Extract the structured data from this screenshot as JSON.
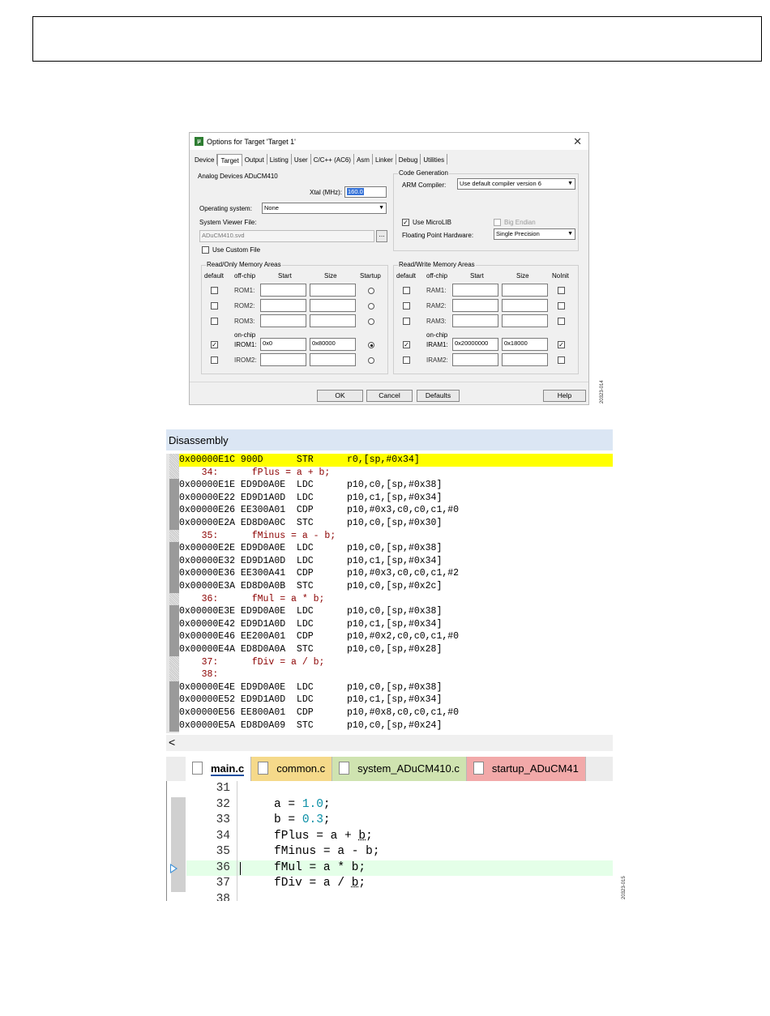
{
  "figure_ids": {
    "dialog": "20323-014",
    "editor": "20323-015"
  },
  "dialog": {
    "title": "Options for Target 'Target 1'",
    "close": "✕",
    "tabs": [
      "Device",
      "Target",
      "Output",
      "Listing",
      "User",
      "C/C++ (AC6)",
      "Asm",
      "Linker",
      "Debug",
      "Utilities"
    ],
    "device": "Analog Devices ADuCM410",
    "xtal_label": "Xtal (MHz):",
    "xtal_value": "160.0",
    "os_label": "Operating system:",
    "os_value": "None",
    "svf_label": "System Viewer File:",
    "svf_value": "ADuCM410.svd",
    "browse": "...",
    "use_custom": "Use Custom File",
    "code_gen": {
      "title": "Code Generation",
      "compiler_label": "ARM Compiler:",
      "compiler_value": "Use default compiler version 6",
      "microlib": "Use MicroLIB",
      "big_endian": "Big Endian",
      "fph_label": "Floating Point Hardware:",
      "fph_value": "Single Precision"
    },
    "ro": {
      "title": "Read/Only Memory Areas",
      "headers": [
        "default",
        "off-chip",
        "Start",
        "Size",
        "Startup"
      ],
      "onchip": "on-chip",
      "rows": [
        {
          "name": "ROM1:",
          "start": "",
          "size": "",
          "default": false,
          "startup": false
        },
        {
          "name": "ROM2:",
          "start": "",
          "size": "",
          "default": false,
          "startup": false
        },
        {
          "name": "ROM3:",
          "start": "",
          "size": "",
          "default": false,
          "startup": false
        },
        {
          "name": "IROM1:",
          "start": "0x0",
          "size": "0x80000",
          "default": true,
          "startup": true
        },
        {
          "name": "IROM2:",
          "start": "",
          "size": "",
          "default": false,
          "startup": false
        }
      ]
    },
    "rw": {
      "title": "Read/Write Memory Areas",
      "headers": [
        "default",
        "off-chip",
        "Start",
        "Size",
        "NoInit"
      ],
      "onchip": "on-chip",
      "rows": [
        {
          "name": "RAM1:",
          "start": "",
          "size": "",
          "default": false,
          "noinit": false
        },
        {
          "name": "RAM2:",
          "start": "",
          "size": "",
          "default": false,
          "noinit": false
        },
        {
          "name": "RAM3:",
          "start": "",
          "size": "",
          "default": false,
          "noinit": false
        },
        {
          "name": "IRAM1:",
          "start": "0x20000000",
          "size": "0x18000",
          "default": true,
          "noinit": true
        },
        {
          "name": "IRAM2:",
          "start": "",
          "size": "",
          "default": false,
          "noinit": false
        }
      ]
    },
    "buttons": {
      "ok": "OK",
      "cancel": "Cancel",
      "defaults": "Defaults",
      "help": "Help"
    }
  },
  "disassembly": {
    "title": "Disassembly",
    "lines": [
      {
        "t": "0x00000E1C 900D      STR      r0,[sp,#0x34]",
        "k": "cur"
      },
      {
        "t": "    34:      fPlus = a + b;",
        "k": "src"
      },
      {
        "t": "0x00000E1E ED9D0A0E  LDC      p10,c0,[sp,#0x38]",
        "k": "asm"
      },
      {
        "t": "0x00000E22 ED9D1A0D  LDC      p10,c1,[sp,#0x34]",
        "k": "asm"
      },
      {
        "t": "0x00000E26 EE300A01  CDP      p10,#0x3,c0,c0,c1,#0",
        "k": "asm"
      },
      {
        "t": "0x00000E2A ED8D0A0C  STC      p10,c0,[sp,#0x30]",
        "k": "asm"
      },
      {
        "t": "    35:      fMinus = a - b;",
        "k": "src"
      },
      {
        "t": "0x00000E2E ED9D0A0E  LDC      p10,c0,[sp,#0x38]",
        "k": "asm"
      },
      {
        "t": "0x00000E32 ED9D1A0D  LDC      p10,c1,[sp,#0x34]",
        "k": "asm"
      },
      {
        "t": "0x00000E36 EE300A41  CDP      p10,#0x3,c0,c0,c1,#2",
        "k": "asm"
      },
      {
        "t": "0x00000E3A ED8D0A0B  STC      p10,c0,[sp,#0x2c]",
        "k": "asm"
      },
      {
        "t": "    36:      fMul = a * b;",
        "k": "src"
      },
      {
        "t": "0x00000E3E ED9D0A0E  LDC      p10,c0,[sp,#0x38]",
        "k": "asm"
      },
      {
        "t": "0x00000E42 ED9D1A0D  LDC      p10,c1,[sp,#0x34]",
        "k": "asm"
      },
      {
        "t": "0x00000E46 EE200A01  CDP      p10,#0x2,c0,c0,c1,#0",
        "k": "asm"
      },
      {
        "t": "0x00000E4A ED8D0A0A  STC      p10,c0,[sp,#0x28]",
        "k": "asm"
      },
      {
        "t": "    37:      fDiv = a / b;",
        "k": "src"
      },
      {
        "t": "    38:",
        "k": "src"
      },
      {
        "t": "0x00000E4E ED9D0A0E  LDC      p10,c0,[sp,#0x38]",
        "k": "asm"
      },
      {
        "t": "0x00000E52 ED9D1A0D  LDC      p10,c1,[sp,#0x34]",
        "k": "asm"
      },
      {
        "t": "0x00000E56 EE800A01  CDP      p10,#0x8,c0,c0,c1,#0",
        "k": "asm"
      },
      {
        "t": "0x00000E5A ED8D0A09  STC      p10,c0,[sp,#0x24]",
        "k": "asm"
      }
    ],
    "scroll_left": "<"
  },
  "editor": {
    "tabs": [
      {
        "label": "main.c",
        "bg": "#ffffff",
        "active": true
      },
      {
        "label": "common.c",
        "bg": "#f5d98a",
        "active": false
      },
      {
        "label": "system_ADuCM410.c",
        "bg": "#cfe3b0",
        "active": false
      },
      {
        "label": "startup_ADuCM41",
        "bg": "#f2a9a9",
        "active": false
      }
    ],
    "lines": [
      {
        "n": "31",
        "code": ""
      },
      {
        "n": "32",
        "code": "a = ",
        "num": "1.0",
        "tail": ";"
      },
      {
        "n": "33",
        "code": "b = ",
        "num": "0.3",
        "tail": ";"
      },
      {
        "n": "34",
        "code": "fPlus = a + ",
        "ul": "b",
        "tail": ";"
      },
      {
        "n": "35",
        "code": "fMinus = a - b;"
      },
      {
        "n": "36",
        "code": "fMul = a * b;",
        "current": true
      },
      {
        "n": "37",
        "code": "fDiv = a / ",
        "ul": "b",
        "tail": ";"
      },
      {
        "n": "38",
        "code": ""
      }
    ]
  }
}
